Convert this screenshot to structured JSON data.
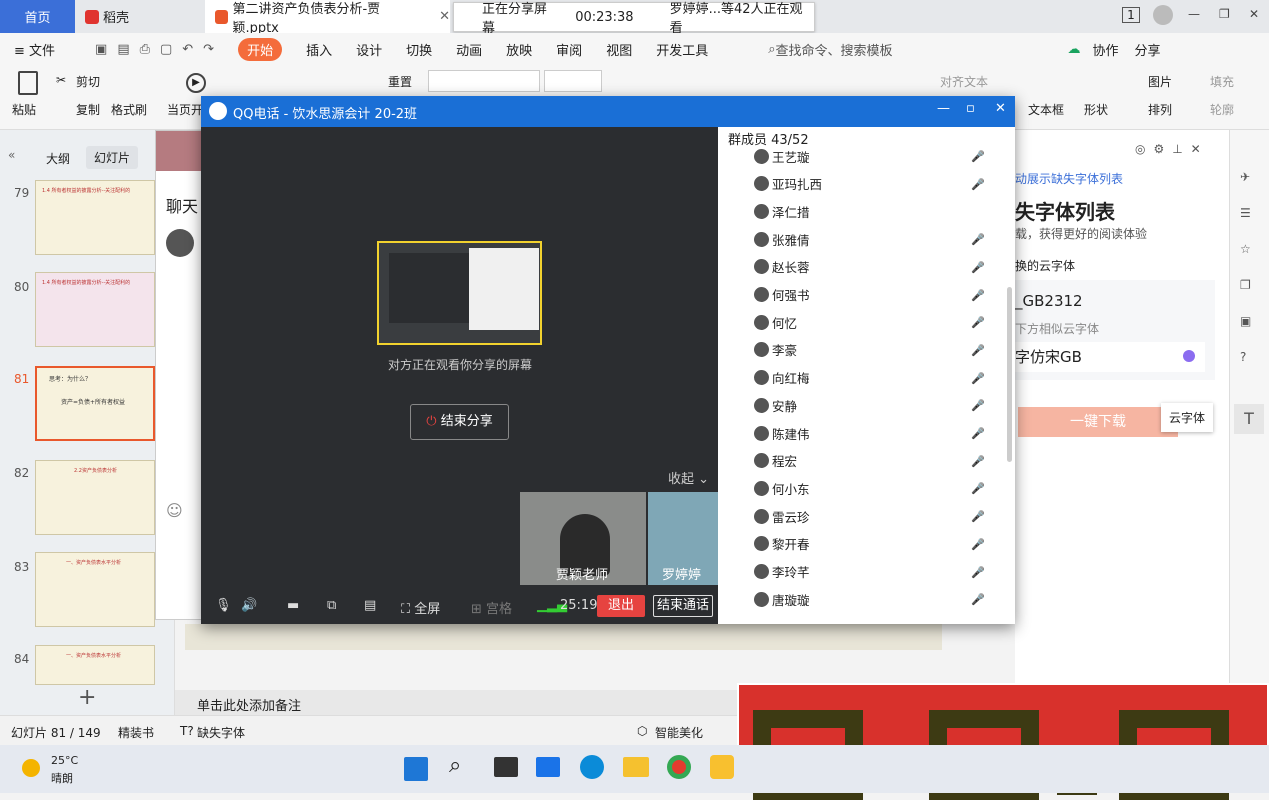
{
  "titlebar": {
    "home_tab": "首页",
    "daoke_tab": "稻壳",
    "doc_tab": "第二讲资产负债表分析-贾颖.pptx",
    "close": "✕",
    "window_controls": [
      "1",
      "—",
      "❐",
      "✕"
    ]
  },
  "share_bar": {
    "status": "正在分享屏幕",
    "timer": "00:23:38",
    "viewers": "罗婷婷...等42人正在观看"
  },
  "menu": {
    "file": "≡ 文件",
    "start": "开始",
    "items": [
      "插入",
      "设计",
      "切换",
      "动画",
      "放映",
      "审阅",
      "视图",
      "开发工具"
    ],
    "search": "查找命令、搜索模板",
    "collab": "协作",
    "share": "分享"
  },
  "ribbon": {
    "paste": "粘贴",
    "cut": "剪切",
    "copy": "复制",
    "format_painter": "格式刷",
    "from_current": "当页开",
    "reset": "重置",
    "align_text": "对齐文本",
    "text_box": "文本框",
    "shape": "形状",
    "picture": "图片",
    "arrange": "排列",
    "fill": "填充",
    "outline": "轮廓"
  },
  "left_panel": {
    "outline_tab": "大纲",
    "slides_tab": "幻灯片",
    "slides": [
      {
        "num": "79",
        "title": "1.4 所有者权益的披露分析--关注配利的",
        "active": false
      },
      {
        "num": "80",
        "title": "1.4 所有者权益的披露分析--关注配利的",
        "active": false
      },
      {
        "num": "81",
        "title": "思考：为什么？",
        "subtitle": "资产=负债+所有者权益",
        "active": true
      },
      {
        "num": "82",
        "title": "2.2资产负债表分析",
        "active": false
      },
      {
        "num": "83",
        "title": "一、资产负债表水平分析",
        "active": false
      },
      {
        "num": "84",
        "title": "一、资产负债表水平分析",
        "active": false
      }
    ],
    "add_label": "+"
  },
  "chat_window": {
    "title": "聊天"
  },
  "notes": {
    "placeholder": "单击此处添加备注"
  },
  "statusbar": {
    "slide_count": "幻灯片 81 / 149",
    "theme": "精装书",
    "missing_fonts": "缺失字体",
    "smart": "智能美化"
  },
  "qq_window": {
    "title": "QQ电话 - 饮水思源会计 20-2班",
    "sharing_text": "对方正在观看你分享的屏幕",
    "end_share": "结束分享",
    "collapse": "收起",
    "video_teacher": "贾颖老师",
    "video_student": "罗婷婷",
    "fullscreen": "全屏",
    "grid": "宫格",
    "duration": "25:19",
    "exit": "退出",
    "end_call": "结束通话",
    "members_header": "群成员 43/52",
    "members": [
      "王艺璇",
      "亚玛扎西",
      "泽仁措",
      "张雅倩",
      "赵长蓉",
      "何强书",
      "何忆",
      "李豪",
      "向红梅",
      "安静",
      "陈建伟",
      "程宏",
      "何小东",
      "雷云珍",
      "黎开春",
      "李玲芊",
      "唐璇璇"
    ],
    "muted": [
      true,
      true,
      false,
      true,
      true,
      true,
      true,
      true,
      true,
      true,
      true,
      true,
      true,
      true,
      true,
      true,
      true
    ]
  },
  "right_panel": {
    "link": "动展示缺失字体列表",
    "heading": "失字体列表",
    "desc": "载，获得更好的阅读体验",
    "replace_label": "换的云字体",
    "font_name": "_GB2312",
    "similar": "下方相似云字体",
    "cloud_font": "字仿宋GB",
    "download_button": "一键下载",
    "tooltip": "云字体"
  },
  "taskbar": {
    "temperature": "25°C",
    "weather": "晴朗"
  },
  "colors": {
    "accent": "#f46c3b",
    "qq_blue": "#1a6fd6",
    "exit_red": "#e64340"
  }
}
